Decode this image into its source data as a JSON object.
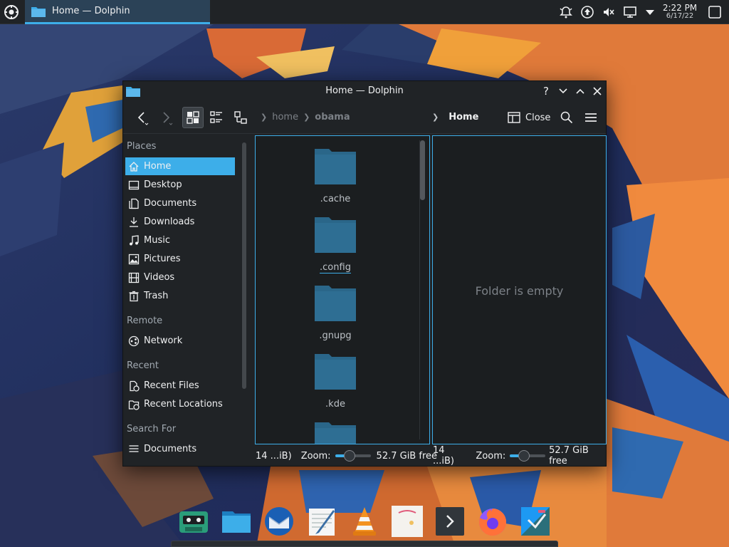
{
  "taskbar": {
    "task_title": "Home — Dolphin",
    "clock_time": "2:22 PM",
    "clock_date": "6/17/22"
  },
  "window": {
    "title": "Home — Dolphin",
    "toolbar": {
      "breadcrumb_left": [
        "home",
        "obama"
      ],
      "breadcrumb_right": "Home",
      "close_label": "Close"
    }
  },
  "places": {
    "sections": [
      {
        "title": "Places",
        "items": [
          {
            "label": "Home",
            "icon": "home-icon",
            "active": true
          },
          {
            "label": "Desktop",
            "icon": "desktop-icon"
          },
          {
            "label": "Documents",
            "icon": "documents-icon"
          },
          {
            "label": "Downloads",
            "icon": "downloads-icon"
          },
          {
            "label": "Music",
            "icon": "music-icon"
          },
          {
            "label": "Pictures",
            "icon": "pictures-icon"
          },
          {
            "label": "Videos",
            "icon": "videos-icon"
          },
          {
            "label": "Trash",
            "icon": "trash-icon"
          }
        ]
      },
      {
        "title": "Remote",
        "items": [
          {
            "label": "Network",
            "icon": "network-icon"
          }
        ]
      },
      {
        "title": "Recent",
        "items": [
          {
            "label": "Recent Files",
            "icon": "recent-files-icon"
          },
          {
            "label": "Recent Locations",
            "icon": "recent-locations-icon"
          }
        ]
      },
      {
        "title": "Search For",
        "items": [
          {
            "label": "Documents",
            "icon": "search-documents-icon"
          }
        ]
      }
    ]
  },
  "left_view": {
    "files": [
      ".cache",
      ".config",
      ".gnupg",
      ".kde"
    ]
  },
  "right_view": {
    "empty_text": "Folder is empty"
  },
  "status_left": {
    "size_text": "14 ...iB)",
    "zoom_label": "Zoom:",
    "free_text": "52.7 GiB free",
    "zoom_fraction": 0.35
  },
  "status_right": {
    "size_text": "14 ...iB)",
    "zoom_label": "Zoom:",
    "free_text": "52.7 GiB free",
    "zoom_fraction": 0.35
  },
  "dock": [
    "cassette-player-icon",
    "dolphin-icon",
    "thunderbird-icon",
    "kwrite-icon",
    "vlc-icon",
    "image-viewer-icon",
    "konsole-icon",
    "firefox-icon",
    "discover-icon"
  ],
  "colors": {
    "accent": "#3daee9",
    "panel": "#202326",
    "view": "#1b1e20",
    "folder": "#2e6e93"
  }
}
